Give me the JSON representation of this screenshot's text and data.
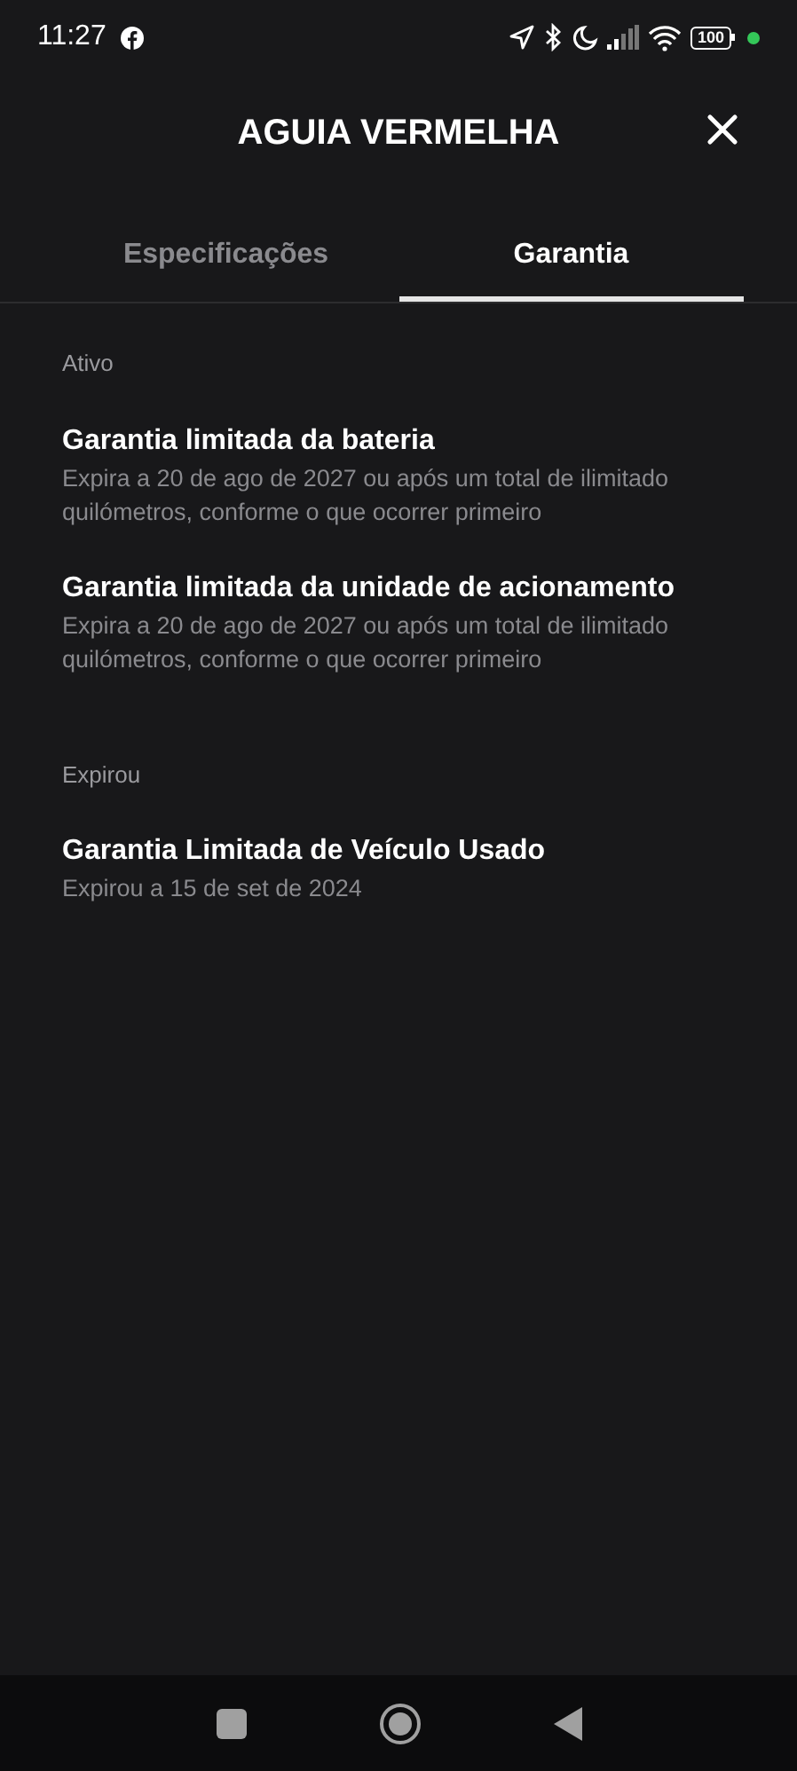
{
  "status_bar": {
    "time": "11:27",
    "battery": "100"
  },
  "header": {
    "title": "AGUIA VERMELHA"
  },
  "tabs": [
    {
      "label": "Especificações",
      "selected": false
    },
    {
      "label": "Garantia",
      "selected": true
    }
  ],
  "sections": [
    {
      "heading": "Ativo",
      "items": [
        {
          "title": "Garantia limitada da bateria",
          "detail": "Expira a 20 de ago de 2027 ou após um total de ilimitado quilómetros, conforme o que ocorrer primeiro"
        },
        {
          "title": "Garantia limitada da unidade de acionamento",
          "detail": "Expira a 20 de ago de 2027 ou após um total de ilimitado quilómetros, conforme o que ocorrer primeiro"
        }
      ]
    },
    {
      "heading": "Expirou",
      "items": [
        {
          "title": "Garantia Limitada de Veículo Usado",
          "detail": "Expirou a 15 de set de 2024"
        }
      ]
    }
  ]
}
